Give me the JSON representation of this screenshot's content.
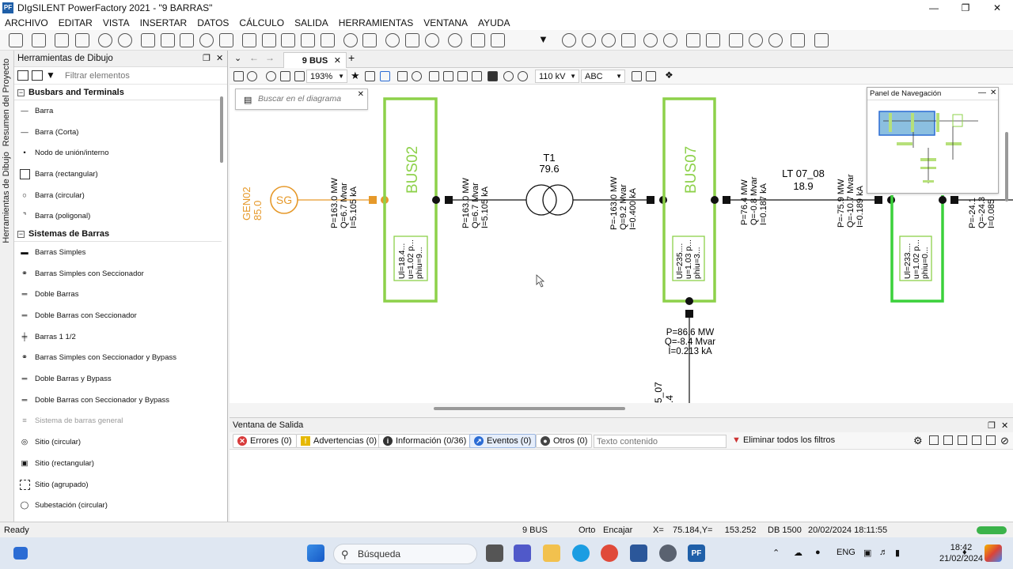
{
  "window": {
    "title": "DIgSILENT PowerFactory 2021 - \"9 BARRAS\"",
    "logo": "PF",
    "controls": [
      "minimize-icon",
      "maximize-icon",
      "close-icon"
    ]
  },
  "menu": [
    "ARCHIVO",
    "EDITAR",
    "VISTA",
    "INSERTAR",
    "DATOS",
    "CÁLCULO",
    "SALIDA",
    "HERRAMIENTAS",
    "VENTANA",
    "AYUDA"
  ],
  "side_tabs": {
    "project": "Resumen del Proyecto",
    "drawing": "Herramientas de Dibujo"
  },
  "drawing_tools": {
    "title": "Herramientas de Dibujo",
    "filter_placeholder": "Filtrar elementos",
    "sections": [
      {
        "title": "Busbars and Terminals",
        "items": [
          "Barra",
          "Barra (Corta)",
          "Nodo de unión/interno",
          "Barra (rectangular)",
          "Barra (circular)",
          "Barra (poligonal)"
        ]
      },
      {
        "title": "Sistemas de Barras",
        "items": [
          "Barras Simples",
          "Barras Simples con Seccionador",
          "Doble Barras",
          "Doble Barras con Seccionador",
          "Barras 1 1/2",
          "Barras Simples con Seccionador y Bypass",
          "Doble Barras y Bypass",
          "Doble Barras con Seccionador y Bypass",
          "Sistema de barras general",
          "Sitio (circular)",
          "Sitio (rectangular)",
          "Sitio (agrupado)",
          "Subestación (circular)"
        ]
      }
    ]
  },
  "doc_tab": {
    "label": "9 BUS"
  },
  "diagram_toolbar": {
    "zoom": "193%",
    "voltage": "110 kV",
    "font": "ABC"
  },
  "search_diagram": {
    "placeholder": "Buscar en el diagrama"
  },
  "nav_panel": {
    "title": "Panel de Navegación"
  },
  "diagram": {
    "gen": {
      "name": "GEN02",
      "value": "85.0",
      "symbol": "SG"
    },
    "gen_flow": [
      "P=163.0 MW",
      "Q=6.7 Mvar",
      "I=5.105 kA"
    ],
    "bus02": {
      "name": "BUS02",
      "res": [
        "Ul=18.4...",
        "u=1.02 p...",
        "phiu=9..."
      ]
    },
    "bus02_right": [
      "P=163.0 MW",
      "Q=6.7 Mvar",
      "I=5.105 kA"
    ],
    "t1": {
      "name": "T1",
      "loading": "79.6"
    },
    "t1_right": [
      "P=-163.0 MW",
      "Q=9.2 Mvar",
      "I=0.400 kA"
    ],
    "bus07": {
      "name": "BUS07",
      "res": [
        "Ul=235....",
        "u=1.03 p...",
        "phiu=3..."
      ]
    },
    "bus07_right": [
      "P=76.4 MW",
      "Q=-0.8 Mvar",
      "I=0.187 kA"
    ],
    "lt": {
      "name": "LT 07_08",
      "loading": "18.9"
    },
    "lt_right": [
      "P=-75.9 MW",
      "Q=-10.7 Mvar",
      "I=0.189 kA"
    ],
    "bus08": {
      "res": [
        "Ul=233....",
        "u=1.02 p...",
        "phiu=0..."
      ]
    },
    "bus08_right": [
      "P=-24.1",
      "Q=-24.3",
      "I=0.085"
    ],
    "bus07_down": [
      "P=86.6 MW",
      "Q=-8.4 Mvar",
      "I=0.213 kA"
    ],
    "bottom_label": [
      "5_07",
      ".4"
    ],
    "colors": {
      "bus": "#8dd14a",
      "gen": "#e6992a",
      "line": "#111111"
    }
  },
  "output": {
    "title": "Ventana de Salida",
    "filters": [
      {
        "label": "Errores (0)",
        "color": "#d83b3b",
        "icon": "error-icon"
      },
      {
        "label": "Advertencias (0)",
        "color": "#e6b800",
        "icon": "warning-icon"
      },
      {
        "label": "Información (0/36)",
        "color": "#333333",
        "icon": "info-icon"
      },
      {
        "label": "Eventos (0)",
        "color": "#2b6cd4",
        "icon": "events-icon"
      },
      {
        "label": "Otros (0)",
        "color": "#444444",
        "icon": "others-icon"
      }
    ],
    "search_placeholder": "Texto contenido",
    "clear_label": "Eliminar todos los filtros"
  },
  "status": {
    "ready": "Ready",
    "graphic": "9 BUS",
    "ortho": "Orto",
    "snap": "Encajar",
    "coords_label": "X=",
    "coords": "75.184,Y=     153.252",
    "db": "DB 1500",
    "datetime": "20/02/2024 18:11:55"
  },
  "taskbar": {
    "search": "Búsqueda",
    "lang": "ENG",
    "time": "18:42",
    "date": "21/02/2024"
  }
}
